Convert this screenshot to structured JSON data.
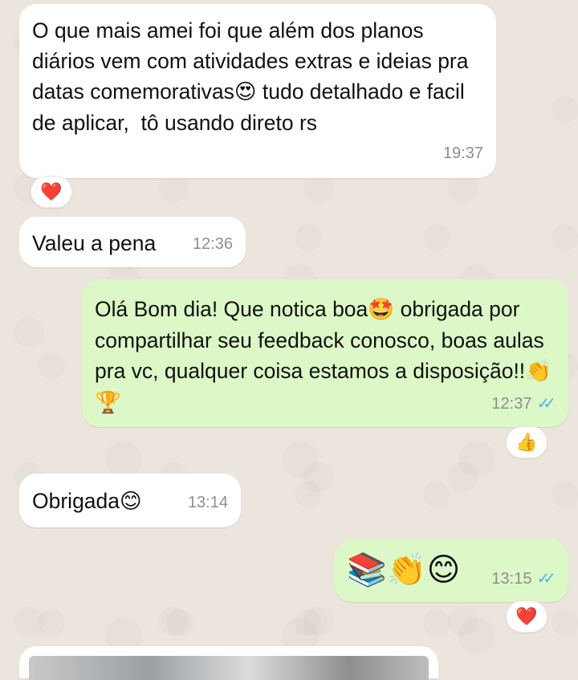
{
  "messages": [
    {
      "text": "O que mais amei foi que além dos planos diários vem com atividades extras e ideias pra datas comemorativas",
      "emoji": "😍",
      "text2": " tudo detalhado e facil de aplicar,  tô usando direto rs",
      "time": "19:37",
      "reaction": "❤️"
    },
    {
      "text": "Valeu a pena",
      "time": "12:36"
    },
    {
      "text": "Olá Bom dia! Que notica boa",
      "emoji": "🤩",
      "text2": " obrigada por compartilhar seu feedback conosco, boas aulas pra vc, qualquer coisa estamos a disposição!!",
      "emoji2": "👏🏆",
      "time": "12:37",
      "ticks": "✓✓",
      "reaction": "👍"
    },
    {
      "text": "Obrigada",
      "emoji": "😊",
      "time": "13:14"
    },
    {
      "emoji": "📚👏😊",
      "time": "13:15",
      "ticks": "✓✓",
      "reaction": "❤️"
    }
  ],
  "icons": {
    "read_receipt": "double-check-icon",
    "reaction_heart": "heart-icon",
    "reaction_thumbs": "thumbs-up-icon"
  },
  "colors": {
    "incoming": "#ffffff",
    "outgoing": "#dcf8c6",
    "tick_blue": "#4fb6ec",
    "background": "#ece5dd"
  }
}
